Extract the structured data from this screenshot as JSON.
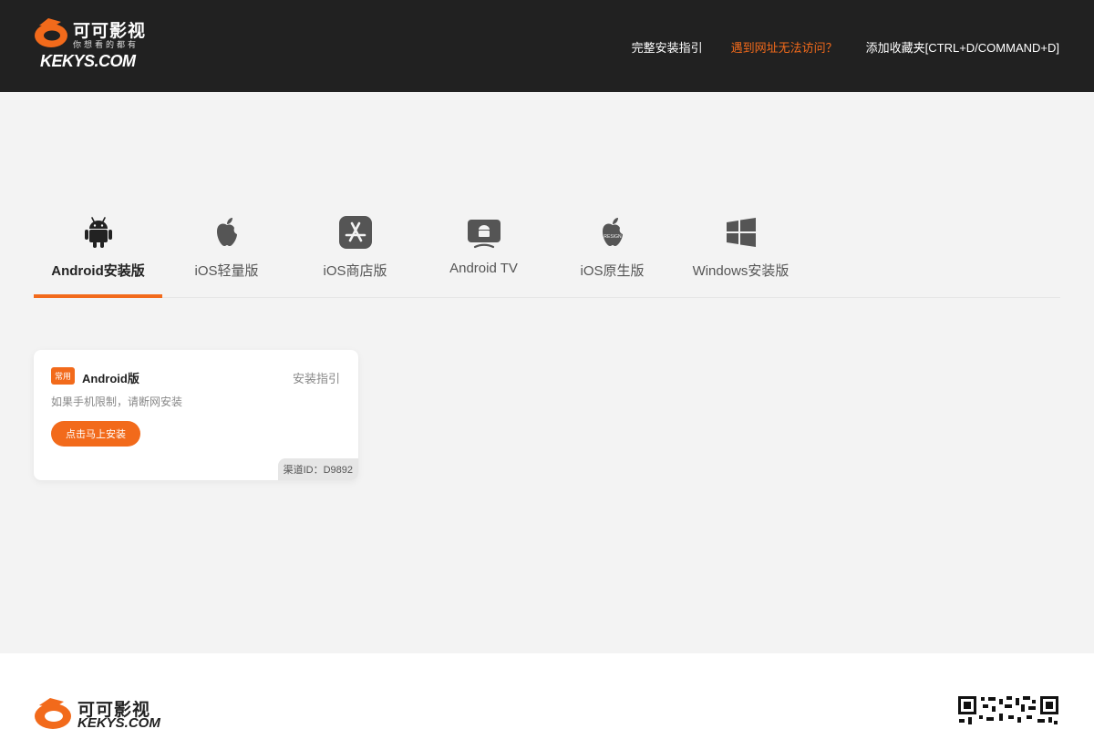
{
  "colors": {
    "accent": "#f26a1b",
    "header_bg": "#212121",
    "page_bg": "#f3f3f3"
  },
  "header": {
    "logo": {
      "name": "可可影视",
      "slogan": "你想看的都有",
      "domain": "KEKYS.COM"
    },
    "nav": [
      {
        "label": "完整安装指引",
        "highlight": false
      },
      {
        "label": "遇到网址无法访问？",
        "highlight": true
      },
      {
        "label": "添加收藏夹[CTRL+D/COMMAND+D]",
        "highlight": false
      }
    ]
  },
  "tabs": [
    {
      "label": "Android安装版",
      "icon": "android-icon",
      "active": true
    },
    {
      "label": "iOS轻量版",
      "icon": "apple-icon",
      "active": false
    },
    {
      "label": "iOS商店版",
      "icon": "app-store-icon",
      "active": false
    },
    {
      "label": "Android TV",
      "icon": "android-tv-icon",
      "active": false
    },
    {
      "label": "iOS原生版",
      "icon": "apple-resign-icon",
      "active": false,
      "icon_text": "RESIGN"
    },
    {
      "label": "Windows安装版",
      "icon": "windows-icon",
      "active": false
    }
  ],
  "card": {
    "badge": "常用",
    "title": "Android版",
    "guide_link": "安装指引",
    "description": "如果手机限制，请断网安装",
    "install_button": "点击马上安装",
    "channel": "渠道ID：D9892"
  },
  "footer": {
    "logo": {
      "name": "可可影视",
      "domain": "KEKYS.COM"
    }
  }
}
